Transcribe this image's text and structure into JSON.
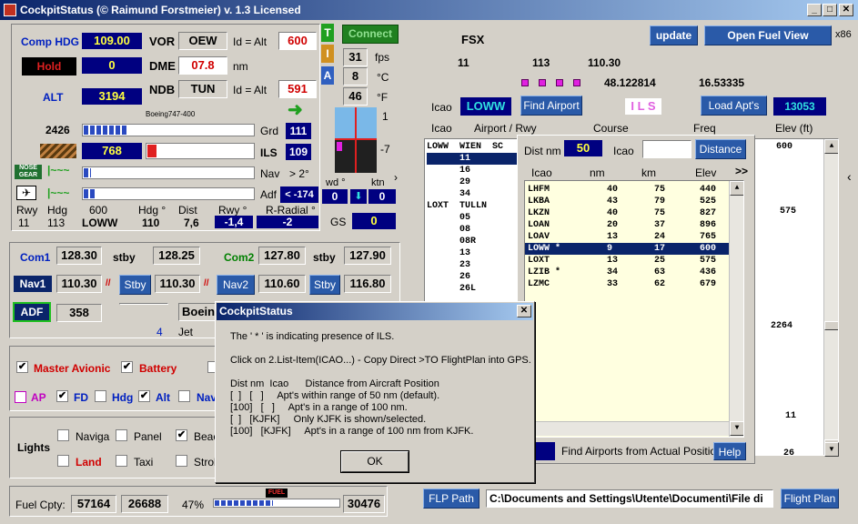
{
  "window": {
    "title": "CockpitStatus (© Raimund Forstmeier) v. 1.3 Licensed"
  },
  "top": {
    "fsx": "FSX",
    "v1": "11",
    "v2": "113",
    "v3": "110.30",
    "lat": "48.122814",
    "lon": "16.53335",
    "ils": "I L S",
    "x86": "x86",
    "update": "update",
    "open_fuel": "Open Fuel View"
  },
  "nav": {
    "comp_hdg_label": "Comp HDG",
    "comp_hdg": "109.00",
    "vor_label": "VOR",
    "vor_id": "OEW",
    "id_alt_label": "Id = Alt",
    "vor_alt": "600",
    "hold": "Hold",
    "hold_val": "0",
    "dme_label": "DME",
    "dme_val": "07.8",
    "nm": "nm",
    "alt_label": "ALT",
    "alt_val": "3194",
    "ndb_label": "NDB",
    "ndb_id": "TUN",
    "ndb_alt": "591",
    "aircraft": "Boeing747-400",
    "v2426": "2426",
    "grd": "Grd",
    "grd_val": "111",
    "v768": "768",
    "ils": "ILS",
    "ils_val": "109",
    "nav_label": "Nav",
    "nav_deg": "> 2°",
    "adf_label": "Adf",
    "adf_val": "< -174",
    "nose_gear": "NOSE GEAR"
  },
  "rwy": {
    "h": [
      "Rwy",
      "Hdg",
      "600",
      "Hdg °",
      "Dist",
      "Rwy °",
      "R-Radial °"
    ],
    "v": [
      "11",
      "113",
      "LOWW",
      "110",
      "7,6",
      "-1,4",
      "-2"
    ]
  },
  "tia": {
    "t": "T",
    "i": "I",
    "a": "A",
    "connect": "Connect",
    "fps": "31",
    "fps_l": "fps",
    "c": "8",
    "c_l": "°C",
    "f": "46",
    "f_l": "°F",
    "wd": "wd °",
    "ktn": "ktn",
    "wd_v": "0",
    "ktn_v": "0",
    "gs": "GS",
    "gs_v": "0",
    "one": "1",
    "m7": "-7"
  },
  "radio": {
    "com1": "Com1",
    "com1_v": "128.30",
    "stby": "stby",
    "com1_s": "128.25",
    "com2": "Com2",
    "com2_v": "127.80",
    "com2_s": "127.90",
    "nav1": "Nav1",
    "nav1_v": "110.30",
    "nav1_s": "110.30",
    "nav2": "Nav2",
    "nav2_v": "110.60",
    "nav2_s": "116.80",
    "stby_btn": "Stby",
    "adf": "ADF",
    "adf_v": "358",
    "boeing": "Boeing",
    "four": "4",
    "jet": "Jet"
  },
  "sw": {
    "master": "Master Avionic",
    "battery": "Battery",
    "ap": "AP",
    "fd": "FD",
    "hdg": "Hdg",
    "alt": "Alt",
    "nav": "Nav",
    "lights": "Lights",
    "naviga": "Naviga",
    "panel": "Panel",
    "beac": "Beac",
    "land": "Land",
    "taxi": "Taxi",
    "strob": "Strob"
  },
  "fuel": {
    "label": "Fuel Cpty:",
    "v1": "57164",
    "v2": "26688",
    "pct": "47%",
    "fuel_tag": "FUEL",
    "v3": "30476"
  },
  "bottom": {
    "flp": "FLP Path",
    "path": "C:\\Documents and Settings\\Utente\\Documenti\\File di",
    "flight_plan": "Flight Plan"
  },
  "airport": {
    "icao_label": "Icao",
    "icao": "LOWW",
    "find": "Find Airport",
    "load": "Load Apt's",
    "count": "13053",
    "cols": [
      "Icao",
      "Airport / Rwy",
      "Course",
      "Freq",
      "Elev (ft)"
    ],
    "elevs": [
      "600",
      "575",
      "2264",
      "11",
      "26"
    ]
  },
  "rwylist": [
    "LOWW  WIEN  SC",
    "      11",
    "      16",
    "      29",
    "      34",
    "LOXT  TULLN",
    "      05",
    "      08",
    "      08R",
    "      13",
    "      23",
    "      26",
    "      26L"
  ],
  "near": {
    "dist_label": "Dist nm",
    "dist": "50",
    "icao_label": "Icao",
    "distance": "Distance",
    "cols": [
      "Icao",
      "nm",
      "km",
      "Elev",
      ">>"
    ],
    "rows": [
      [
        "LHFM",
        "40",
        "75",
        "440"
      ],
      [
        "LKBA",
        "43",
        "79",
        "525"
      ],
      [
        "LKZN",
        "40",
        "75",
        "827"
      ],
      [
        "LOAN",
        "20",
        "37",
        "896"
      ],
      [
        "LOAV",
        "13",
        "24",
        "765"
      ],
      [
        "LOWW *",
        "9",
        "17",
        "600"
      ],
      [
        "LOXT",
        "13",
        "25",
        "575"
      ],
      [
        "LZIB *",
        "34",
        "63",
        "436"
      ],
      [
        "LZMC",
        "33",
        "62",
        "679"
      ]
    ],
    "find_actual": "Find Airports from Actual Position",
    "help": "Help"
  },
  "dialog": {
    "title": "CockpitStatus",
    "l1": "The ' * ' is indicating presence of ILS.",
    "l2": "Click on 2.List-Item(ICAO...) - Copy Direct >TO FlightPlan into GPS.",
    "l3": "Dist nm  Icao      Distance from Aircraft Position",
    "l4": "[  ]   [   ]     Apt's within range of 50 nm (default).",
    "l5": "[100]   [   ]     Apt's in a range of 100 nm.",
    "l6": "[  ]   [KJFK]     Only KJFK is shown/selected.",
    "l7": "[100]   [KJFK]     Apt's in a range of 100 nm from KJFK.",
    "ok": "OK"
  }
}
